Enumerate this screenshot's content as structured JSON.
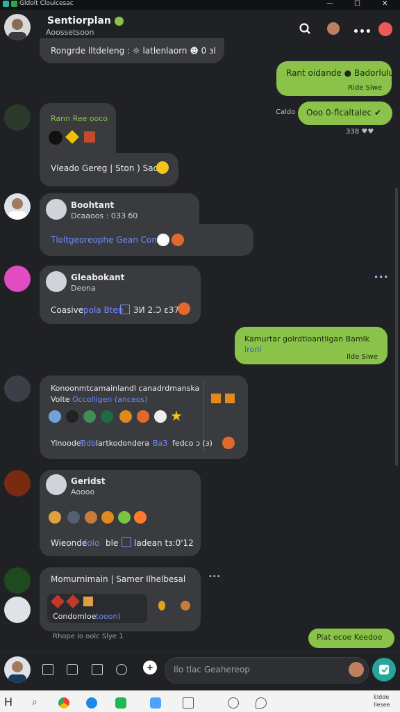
{
  "window": {
    "title": "Gldolt Clouicesac",
    "minimize": "—",
    "maximize": "☐",
    "close": "✕"
  },
  "header": {
    "name": "Sentiorplan",
    "status": "Aoossetsoon"
  },
  "messages": {
    "m0": {
      "text": "Rongrde lltdeleng : ☼ latlenlaorn ☻ 0 ɜl"
    },
    "m1": {
      "text": "Rant oidande ● Badorlulu",
      "time": "Ride Siwe"
    },
    "m2": {
      "side_label": "Caldo",
      "text": "Ooo 0-flcaltalec ✔",
      "time": "ЗЗ8 ♥♥"
    },
    "m3": {
      "sender": "Rann Ree ooco",
      "text": "Vleado Gereg | Ston  ) Sadl"
    },
    "m4": {
      "sender": "Boohtant",
      "status": "Dcaaoos : 0ЗЗ  б0",
      "text": "Tloltgeoreophe Gean Con ℍ"
    },
    "m5": {
      "sender": "Gleabokant",
      "status": "Deona",
      "text_a": "Coasive",
      "text_b": "pola Bten",
      "text_c": "ЗИ 2.Ɔ ɛЗ7"
    },
    "m6": {
      "text": "Kamurtar golrdtloantligan Bamlk",
      "text_b": "Ironl",
      "time": "Ilde Siwe"
    },
    "m7": {
      "title": "Konoonmtcamainlandl canadrdmanska",
      "sub_a": "Volte",
      "sub_b": "Occolligen (anceos)",
      "text_a": "Yinoode",
      "text_b": "Ɓdb",
      "text_c": "lartkodondera",
      "text_d": "ВаЗ",
      "text_e": "fedco  ɔ (ɜ)"
    },
    "m8": {
      "sender": "Geridst",
      "status": "Aoooo",
      "text_a": "Wieonde",
      "text_b": "lolo",
      "text_c": "ble",
      "text_d": "ladean  tɜ:0'12"
    },
    "m9": {
      "title": "Momurnimain | Samer Ilhelbesal",
      "inner": "Condomloe",
      "inner_b": "tooon)",
      "caption": "Rhope lo oolc Slye  1"
    },
    "m10": {
      "text": "Piat ecoe Keedoe"
    }
  },
  "typing": "•••",
  "input": {
    "placeholder": "Ilo tlac Geahereop"
  },
  "taskbar": {
    "letter": "H",
    "clock_a": "Ɛldde",
    "clock_b": "Ilesee"
  },
  "colors": {
    "bg": "#202124",
    "bubble_in": "#3a3b3e",
    "bubble_out": "#8bc34a",
    "accent": "#26a69a"
  }
}
